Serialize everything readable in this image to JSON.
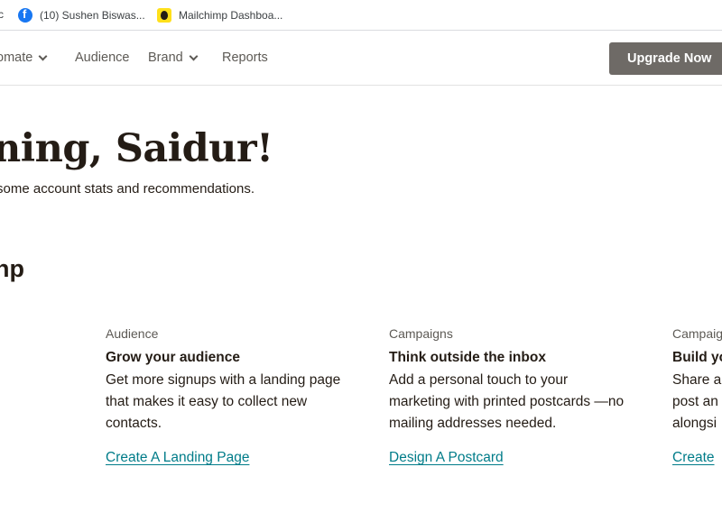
{
  "bookmarks": {
    "partial_label": "c",
    "items": [
      {
        "label": "(10) Sushen Biswas...",
        "icon": "facebook-icon"
      },
      {
        "label": "Mailchimp Dashboa...",
        "icon": "mailchimp-icon"
      }
    ]
  },
  "nav": {
    "items": [
      {
        "label": "omate",
        "has_dropdown": true
      },
      {
        "label": "Audience",
        "has_dropdown": false
      },
      {
        "label": "Brand",
        "has_dropdown": true
      },
      {
        "label": "Reports",
        "has_dropdown": false
      }
    ],
    "upgrade_label": "Upgrade Now"
  },
  "greeting": {
    "title": "ning, Saidur!",
    "subtitle": "some account stats and recommendations."
  },
  "section": {
    "title": "np"
  },
  "cards": [
    {
      "category": "Audience",
      "heading": "Grow your audience",
      "description": "Get more signups with a landing page that makes it easy to collect new contacts.",
      "link": "Create A Landing Page"
    },
    {
      "category": "Campaigns",
      "heading": "Think outside the inbox",
      "description": "Add a personal touch to your marketing with printed postcards —no mailing addresses needed.",
      "link": "Design A Postcard"
    },
    {
      "category": "Campaig",
      "heading": "Build yo",
      "description": "Share a post an alongsi",
      "link": "Create"
    }
  ],
  "colors": {
    "accent_link": "#007c89",
    "upgrade_button": "#6e6a66",
    "text": "#241c15"
  }
}
